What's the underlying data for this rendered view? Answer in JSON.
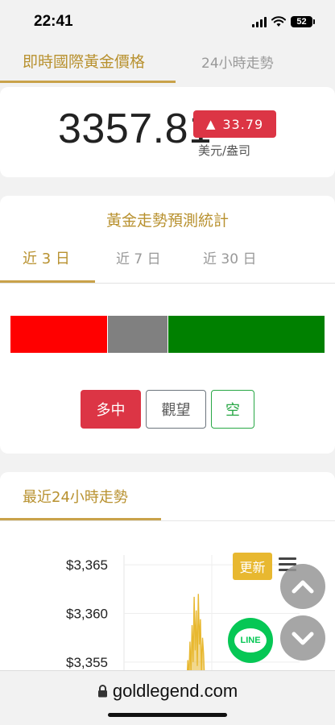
{
  "status_bar": {
    "time": "22:41",
    "battery": "52"
  },
  "top_tabs": {
    "active": "即時國際黃金價格",
    "inactive": "24小時走勢"
  },
  "price": {
    "value": "3357.81",
    "change": "33.79",
    "change_direction": "up",
    "unit": "美元/盎司"
  },
  "forecast": {
    "title": "黃金走勢預測統計",
    "periods": [
      "近 3 日",
      "近 7 日",
      "近 30 日"
    ],
    "active_period": "近 3 日",
    "distribution": [
      {
        "key": "long",
        "fraction": 0.31,
        "color": "#ff0000"
      },
      {
        "key": "neutral",
        "fraction": 0.19,
        "color": "#808080"
      },
      {
        "key": "short",
        "fraction": 0.5,
        "color": "#008000"
      }
    ],
    "buttons": {
      "long": "多中",
      "watch": "觀望",
      "short": "空"
    }
  },
  "trend": {
    "title": "最近24小時走勢",
    "refresh_label": "更新"
  },
  "chart_data": {
    "type": "area",
    "title": "",
    "xlabel": "",
    "ylabel": "",
    "y_ticks": [
      "$3,365",
      "$3,360",
      "$3,355"
    ],
    "y_tick_values": [
      3365,
      3360,
      3355
    ],
    "ylim": [
      3353,
      3366
    ],
    "grid": true,
    "series_color": "#e8b830",
    "values": [
      3353,
      3355.2,
      3353.4,
      3357.1,
      3354,
      3358.8,
      3355,
      3361.7,
      3356.2,
      3360.3,
      3354.6,
      3362,
      3356.8,
      3359.4,
      3353.9,
      3357.5,
      3355.8,
      3353
    ]
  },
  "address_bar": {
    "url": "goldlegend.com"
  },
  "line_button": {
    "label": "LINE"
  }
}
